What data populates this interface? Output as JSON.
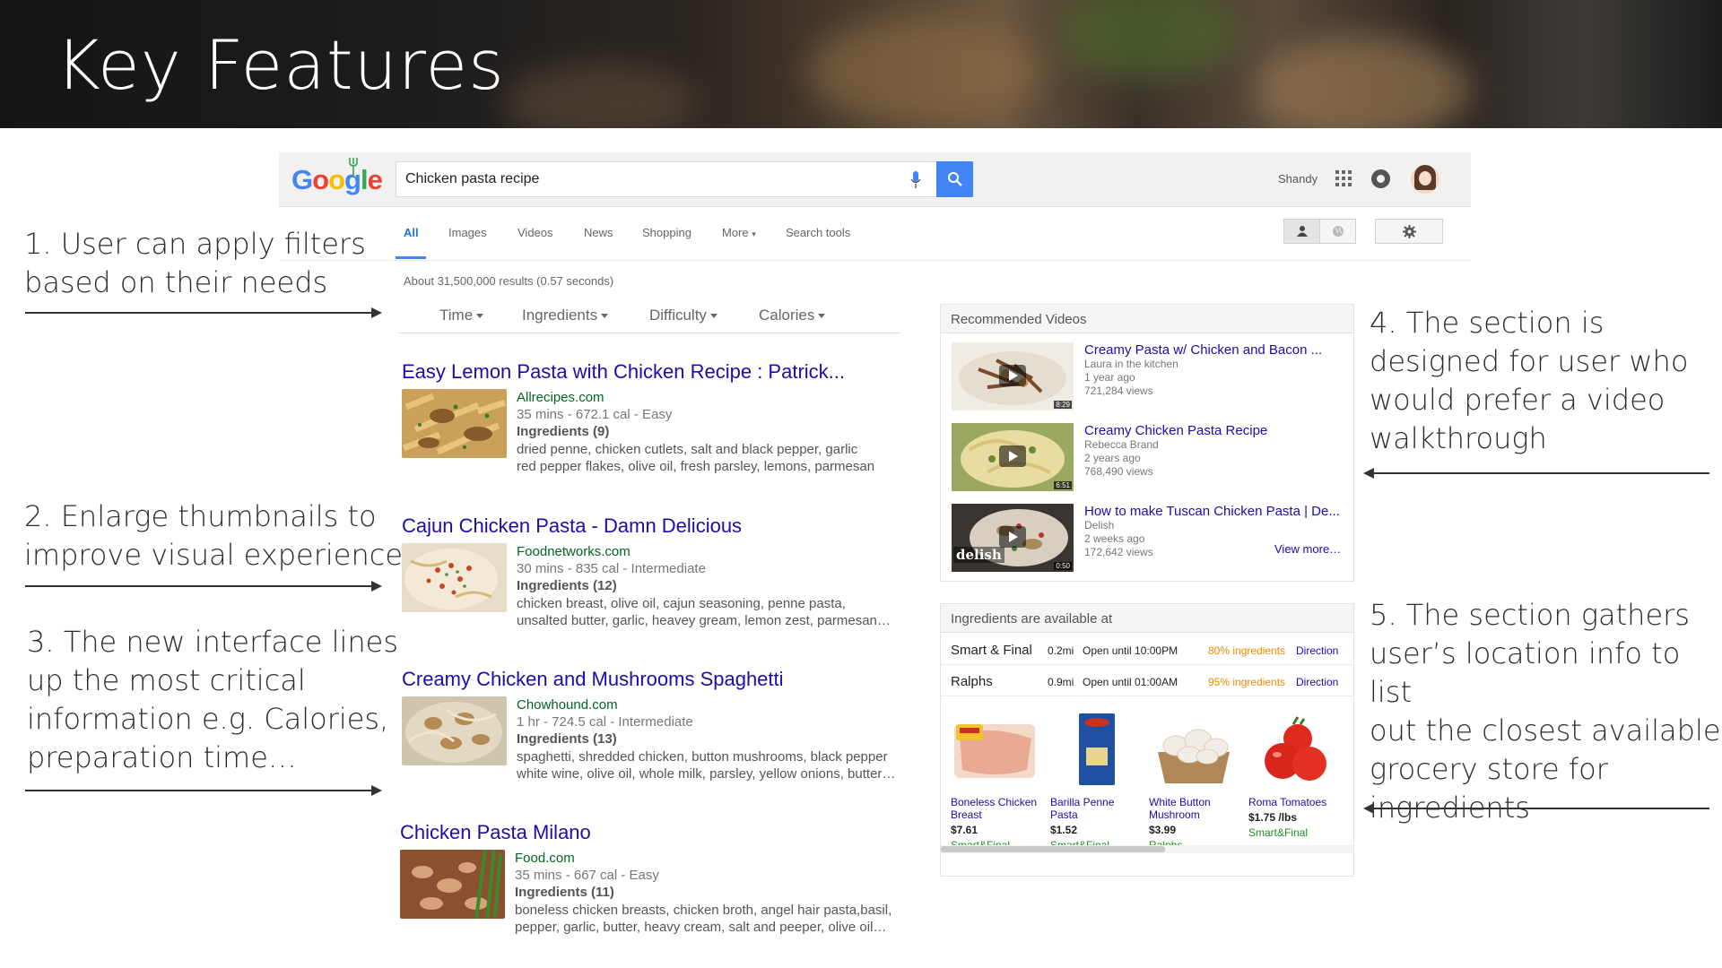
{
  "slide": {
    "title": "Key Features"
  },
  "annotations": [
    {
      "lines": [
        "1. User can apply filters",
        "based on their needs"
      ]
    },
    {
      "lines": [
        "2. Enlarge thumbnails to",
        "improve visual experience"
      ]
    },
    {
      "lines": [
        "3. The new interface lines",
        "up the most critical",
        "information e.g. Calories,",
        "preparation time…"
      ]
    },
    {
      "lines": [
        "4. The section is",
        "designed for user who",
        "would prefer a video",
        "walkthrough"
      ]
    },
    {
      "lines": [
        "5. The section gathers",
        "user’s location info to list",
        "out the closest available",
        "grocery store for",
        "ingredients"
      ]
    }
  ],
  "google": {
    "search_query": "Chicken pasta recipe",
    "user_name": "Shandy",
    "tabs": [
      "All",
      "Images",
      "Videos",
      "News",
      "Shopping",
      "More",
      "Search tools"
    ],
    "result_stats": "About 31,500,000 results (0.57 seconds)",
    "filters": [
      "Time",
      "Ingredients",
      "Difficulty",
      "Calories"
    ]
  },
  "results": [
    {
      "title": "Easy Lemon Pasta with Chicken Recipe : Patrick...",
      "site": "Allrecipes.com",
      "meta": "35 mins - 672.1 cal - Easy",
      "ingredients_label": "Ingredients (9)",
      "ingredients": [
        "dried penne, chicken cutlets, salt and black pepper, garlic",
        "red pepper flakes, olive oil, fresh parsley, lemons, parmesan"
      ]
    },
    {
      "title": "Cajun Chicken Pasta - Damn Delicious",
      "site": "Foodnetworks.com",
      "meta": "30 mins - 835 cal - Intermediate",
      "ingredients_label": "Ingredients (12)",
      "ingredients": [
        "chicken breast, olive oil, cajun seasoning, penne pasta,",
        "unsalted butter, garlic, heavey gream, lemon zest, parmesan…"
      ]
    },
    {
      "title": "Creamy Chicken and Mushrooms Spaghetti",
      "site": "Chowhound.com",
      "meta": "1 hr - 724.5 cal - Intermediate",
      "ingredients_label": "Ingredients (13)",
      "ingredients": [
        "spaghetti, shredded chicken, button mushrooms, black pepper",
        "white wine, olive oil, whole milk, parsley, yellow onions, butter…"
      ]
    },
    {
      "title": "Chicken Pasta Milano",
      "site": "Food.com",
      "meta": "35 mins - 667 cal - Easy",
      "ingredients_label": "Ingredients (11)",
      "ingredients": [
        "boneless chicken breasts, chicken broth, angel hair pasta,basil,",
        "pepper, garlic, butter, heavy cream, salt and peeper, olive oil…"
      ]
    }
  ],
  "videos_panel": {
    "heading": "Recommended Videos",
    "view_more": "View more…",
    "videos": [
      {
        "title": "Creamy Pasta w/ Chicken and Bacon ...",
        "channel": "Laura in the kitchen",
        "age": "1 year ago",
        "views": "721,284 views",
        "duration": "8:29"
      },
      {
        "title": "Creamy Chicken Pasta Recipe",
        "channel": "Rebecca Brand",
        "age": "2 years ago",
        "views": "768,490 views",
        "duration": "6:51"
      },
      {
        "title": "How to make Tuscan Chicken Pasta | De...",
        "channel": "Delish",
        "age": "2 weeks ago",
        "views": "172,642 views",
        "duration": "0:50",
        "badge": "delish"
      }
    ]
  },
  "stores_panel": {
    "heading": "Ingredients are available at",
    "stores": [
      {
        "name": "Smart & Final",
        "distance": "0.2mi",
        "hours": "Open until 10:00PM",
        "availability": "80% ingredients",
        "action": "Direction"
      },
      {
        "name": "Ralphs",
        "distance": "0.9mi",
        "hours": "Open until 01:00AM",
        "availability": "95% ingredients",
        "action": "Direction"
      }
    ],
    "products": [
      {
        "name": "Boneless Chicken Breast",
        "price": "$7.61",
        "store": "Smart&Final"
      },
      {
        "name": "Barilla Penne Pasta",
        "price": "$1.52",
        "store": "Smart&Final"
      },
      {
        "name": "White Button Mushroom",
        "price": "$3.99",
        "store": "Ralphs"
      },
      {
        "name": "Roma Tomatoes",
        "price": "$1.75 /lbs",
        "store": "Smart&Final"
      }
    ]
  },
  "colors": {
    "link": "#1a0dab",
    "site_url": "#006621",
    "google_blue": "#4285f4",
    "availability": "#f08a00"
  }
}
